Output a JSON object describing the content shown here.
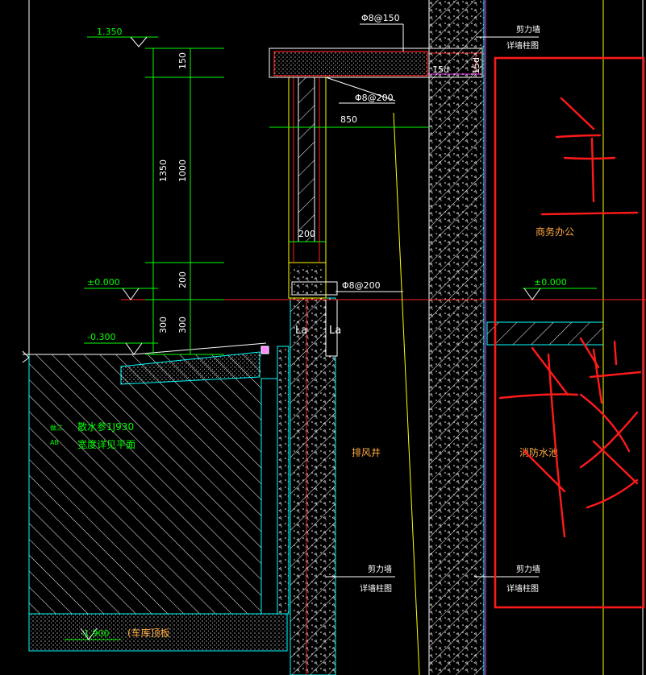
{
  "levels": {
    "top": "1.350",
    "zero_left": "±0.000",
    "minus": "-0.300",
    "zero_right": "±0.000",
    "garage": "-1.900"
  },
  "dims": {
    "d150": "150",
    "d1350": "1350",
    "d1000": "1000",
    "d200": "200",
    "d300": "300",
    "d850": "850",
    "d200b": "200",
    "d15d_a": "15d",
    "d15d_b": "15d"
  },
  "rebar": {
    "top": "Φ8@150",
    "mid": "Φ8@200",
    "low": "Φ8@200"
  },
  "labels": {
    "la1": "La",
    "la2": "La",
    "shear_top_1": "剪力墙",
    "shear_top_2": "详墙柱图",
    "shear_mid_1": "剪力墙",
    "shear_mid_2": "详墙柱图",
    "shear_bot_1": "剪力墙",
    "shear_bot_2": "详墙柱图",
    "office": "商务办公",
    "exhaust": "排风井",
    "fire_pool": "消防水池",
    "drain_tag": "做三",
    "drain_tag2": "AB",
    "drain_1": "散水参1J930",
    "drain_2": "宽度详见平面",
    "garage_roof": "(车库顶板"
  },
  "colors": {
    "bg": "#000000",
    "concrete": "#ffffff",
    "dim_green": "#00ff00",
    "cyan": "#00ffff",
    "yellow": "#ffff00",
    "orange": "#ffaa44",
    "red_line": "#ff2020",
    "markup_red": "#ff1a1a",
    "magenta": "#ff33ff"
  }
}
